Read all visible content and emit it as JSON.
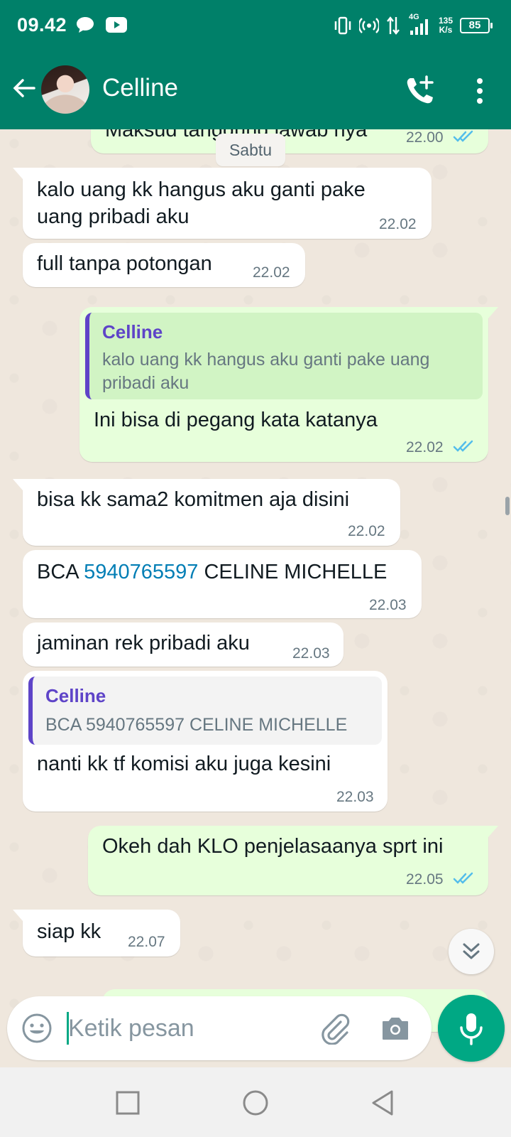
{
  "status_bar": {
    "time": "09.42",
    "network": "4G",
    "speed_value": "135",
    "speed_unit": "K/s",
    "battery": "85"
  },
  "header": {
    "contact_name": "Celline"
  },
  "chat": {
    "partial_top": {
      "text": "Maksud tanggung jawab nya",
      "time": "22.00"
    },
    "date_chip": "Sabtu",
    "messages": [
      {
        "line1": "kalo uang kk hangus aku ganti pake",
        "line2": "uang pribadi aku",
        "time": "22.02"
      },
      {
        "text": "full tanpa potongan",
        "time": "22.02"
      },
      {
        "quote_author": "Celline",
        "quote_line1": "kalo uang kk hangus aku ganti pake uang",
        "quote_line2": "pribadi aku",
        "text": "Ini bisa di pegang kata katanya",
        "time": "22.02"
      },
      {
        "text": "bisa kk sama2 komitmen aja disini",
        "time": "22.02"
      },
      {
        "prefix": "BCA ",
        "number": "5940765597",
        "suffix": " CELINE MICHELLE",
        "time": "22.03"
      },
      {
        "text": "jaminan rek pribadi aku",
        "time": "22.03"
      },
      {
        "quote_author": "Celline",
        "quote_text": "BCA 5940765597 CELINE MICHELLE",
        "text": "nanti kk tf komisi aku juga kesini",
        "time": "22.03"
      },
      {
        "text": "Okeh dah KLO penjelasaanya sprt ini",
        "time": "22.05"
      },
      {
        "text": "siap kk",
        "time": "22.07"
      }
    ]
  },
  "composer": {
    "placeholder": "Ketik pesan"
  },
  "colors": {
    "header": "#008069",
    "outgoing_bubble": "#e7ffdb",
    "incoming_bubble": "#ffffff",
    "accent": "#00a884",
    "read_ticks": "#53bdeb",
    "quote_bar": "#5e44c8"
  },
  "icons": [
    "back-arrow-icon",
    "add-call-icon",
    "more-vert-icon",
    "emoji-icon",
    "attach-icon",
    "camera-icon",
    "mic-icon",
    "double-chevron-down-icon",
    "double-check-icon"
  ]
}
